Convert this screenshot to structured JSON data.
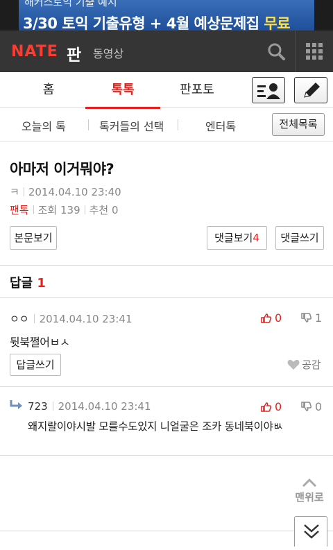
{
  "ad": {
    "top_text": "해커스토익 기출 예시",
    "main_text": "3/30 토익 기출유형 + 4월 예상문제집 ",
    "free_label": "무료"
  },
  "header": {
    "logo": "NATE",
    "logo_suffix": "판",
    "video_link": "동영상"
  },
  "tabs": [
    {
      "label": "홈",
      "active": false
    },
    {
      "label": "톡톡",
      "active": true
    },
    {
      "label": "판포토",
      "active": false
    }
  ],
  "subnav": {
    "items": [
      "오늘의 톡",
      "톡커들의 선택",
      "엔터톡"
    ],
    "all_list": "전체목록"
  },
  "post": {
    "title": "아마저 이거뭐야?",
    "author": "ㅋ",
    "date": "2014.04.10 23:40",
    "category": "팬톡",
    "views": "조회 139",
    "recommend": "추천 0"
  },
  "actions": {
    "view_body": "본문보기",
    "view_comments": "댓글보기",
    "comment_count": "4",
    "write_comment": "댓글쓰기"
  },
  "replies": {
    "header": "답글",
    "count": "1"
  },
  "comments": [
    {
      "author": "ㅇㅇ",
      "date": "2014.04.10 23:41",
      "up": "0",
      "down": "1",
      "text": "뒷북쩔어ㅂㅅ",
      "reply_button": "답글쓰기",
      "empathy": "공감"
    },
    {
      "author": "723",
      "date": "2014.04.10 23:41",
      "up": "0",
      "down": "0",
      "text": "왜지랄이야시발 모를수도있지 니얼굴은 조카 동네북이야ㅄ"
    }
  ],
  "to_top": "맨위로",
  "colors": {
    "accent": "#e8201b",
    "header_bg": "#353535"
  }
}
